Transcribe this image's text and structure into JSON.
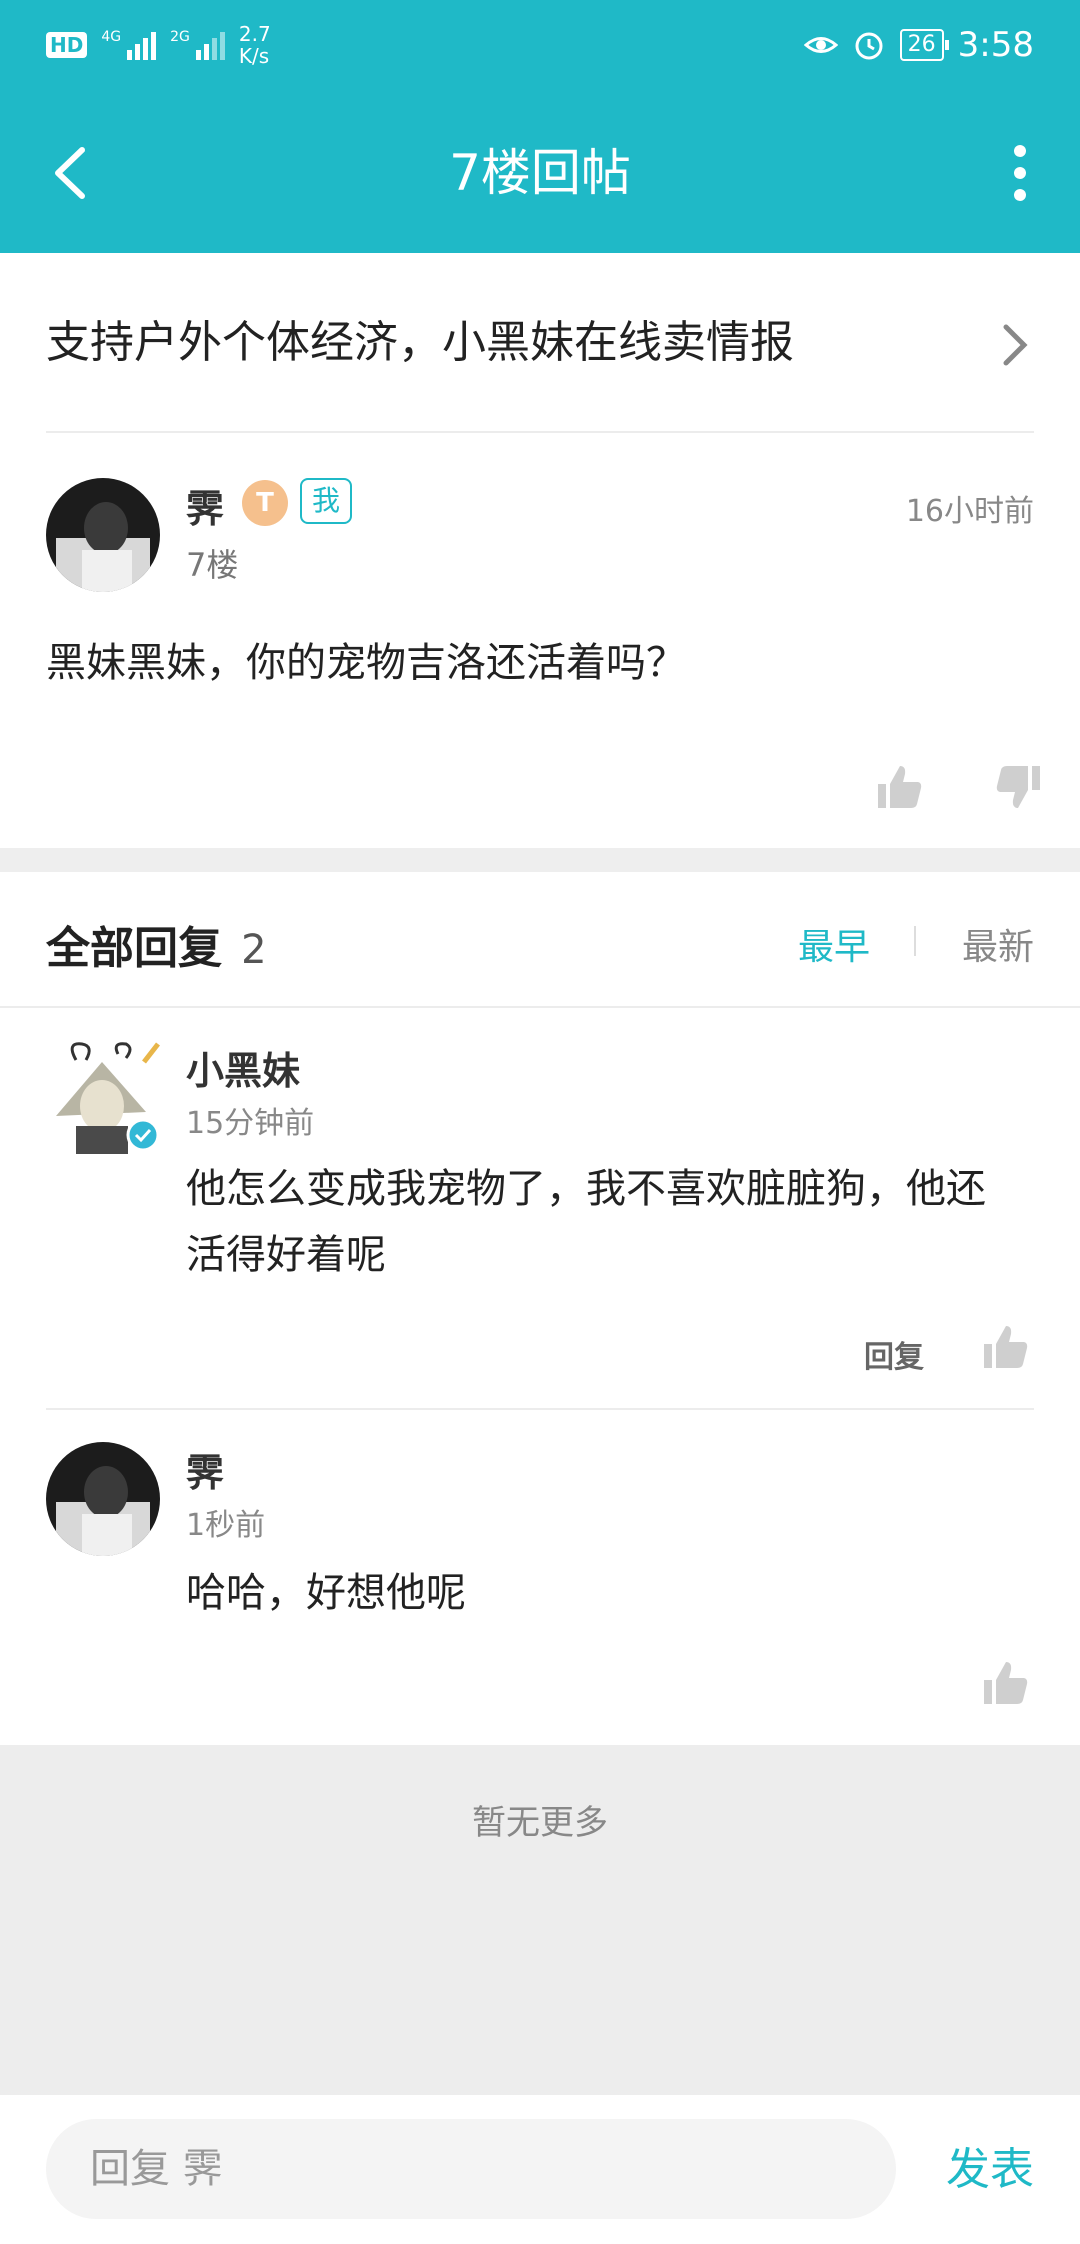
{
  "status_bar": {
    "hd": "HD",
    "sim1_label": "4G",
    "sim2_label": "2G",
    "speed_value": "2.7",
    "speed_unit": "K/s",
    "battery": "26",
    "time": "3:58"
  },
  "app_bar": {
    "title": "7楼回帖"
  },
  "thread": {
    "title": "支持户外个体经济，小黑妹在线卖情报"
  },
  "post": {
    "author": "霁",
    "level": "T",
    "me_badge": "我",
    "floor": "7楼",
    "time": "16小时前",
    "content": "黑妹黑妹，你的宠物吉洛还活着吗？"
  },
  "replies_header": {
    "title": "全部回复",
    "count": "2",
    "sort_earliest": "最早",
    "sort_newest": "最新"
  },
  "replies": [
    {
      "author": "小黑妹",
      "time": "15分钟前",
      "content_line1": "他怎么变成我宠物了，我不喜欢脏脏狗，他还",
      "content_line2": "活得好着呢",
      "reply_label": "回复"
    },
    {
      "author": "霁",
      "time": "1秒前",
      "content": "哈哈，好想他呢"
    }
  ],
  "footer": {
    "no_more": "暂无更多"
  },
  "bottom_bar": {
    "placeholder": "回复 霁",
    "publish": "发表"
  },
  "colors": {
    "accent": "#1fb9c7",
    "background": "#ffffff",
    "divider": "#eeeeee"
  }
}
